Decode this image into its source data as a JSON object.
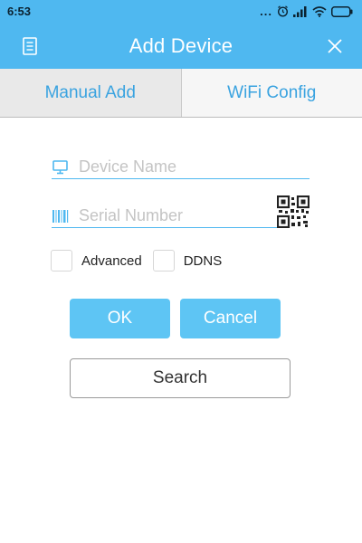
{
  "status_bar": {
    "time": "6:53",
    "dots": "...",
    "icons": [
      "alarm-icon",
      "signal-icon",
      "wifi-icon",
      "battery-icon"
    ]
  },
  "app_bar": {
    "title": "Add Device",
    "left_icon": "document-icon",
    "right_icon": "close-icon"
  },
  "tabs": [
    {
      "label": "Manual Add",
      "active": true
    },
    {
      "label": "WiFi Config",
      "active": false
    }
  ],
  "form": {
    "device_name": {
      "placeholder": "Device Name",
      "value": "",
      "icon": "monitor-icon"
    },
    "serial_number": {
      "placeholder": "Serial Number",
      "value": "",
      "icon": "barcode-icon",
      "scan_icon": "qr-code-icon"
    },
    "checkboxes": [
      {
        "label": "Advanced",
        "checked": false
      },
      {
        "label": "DDNS",
        "checked": false
      }
    ]
  },
  "buttons": {
    "ok": "OK",
    "cancel": "Cancel",
    "search": "Search"
  },
  "colors": {
    "primary": "#4fb8f0",
    "button": "#5ec5f4",
    "tab_text": "#3aa3e0"
  }
}
